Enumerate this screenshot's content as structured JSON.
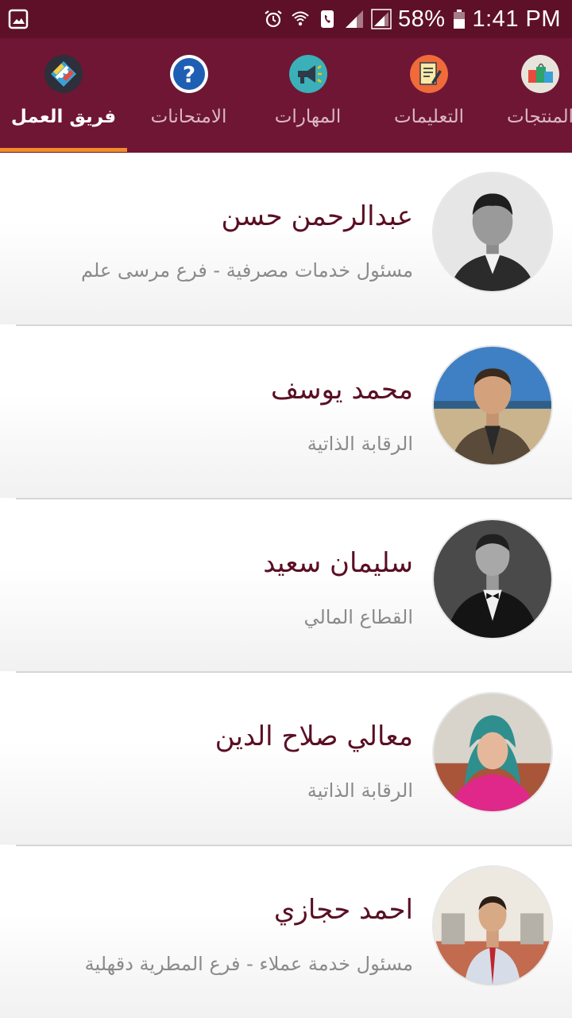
{
  "status_bar": {
    "battery": "58%",
    "time": "1:41 PM",
    "icons": [
      "gallery-icon",
      "alarm-icon",
      "wifi-calling-icon",
      "phone-icon",
      "signal-icon",
      "signal-icon",
      "battery-icon"
    ]
  },
  "tabs": [
    {
      "label": "فريق العمل",
      "icon": "team-handshake-icon",
      "active": true
    },
    {
      "label": "الامتحانات",
      "icon": "question-icon",
      "active": false
    },
    {
      "label": "المهارات",
      "icon": "megaphone-icon",
      "active": false
    },
    {
      "label": "التعليمات",
      "icon": "notepad-icon",
      "active": false
    },
    {
      "label": "المنتجات",
      "icon": "products-icon",
      "active": false
    }
  ],
  "team": [
    {
      "name": "عبدالرحمن حسن",
      "role": "مسئول خدمات مصرفية - فرع مرسى علم"
    },
    {
      "name": "محمد يوسف",
      "role": "الرقابة الذاتية"
    },
    {
      "name": "سليمان سعيد",
      "role": "القطاع المالي"
    },
    {
      "name": "معالي صلاح الدين",
      "role": "الرقابة الذاتية"
    },
    {
      "name": "احمد حجازي",
      "role": "مسئول خدمة عملاء - فرع المطرية دقهلية"
    }
  ],
  "colors": {
    "status_bar": "#5e1029",
    "tab_bar": "#6f1634",
    "indicator": "#f08c2a",
    "name_text": "#5a0f24",
    "role_text": "#8a8a8a"
  }
}
